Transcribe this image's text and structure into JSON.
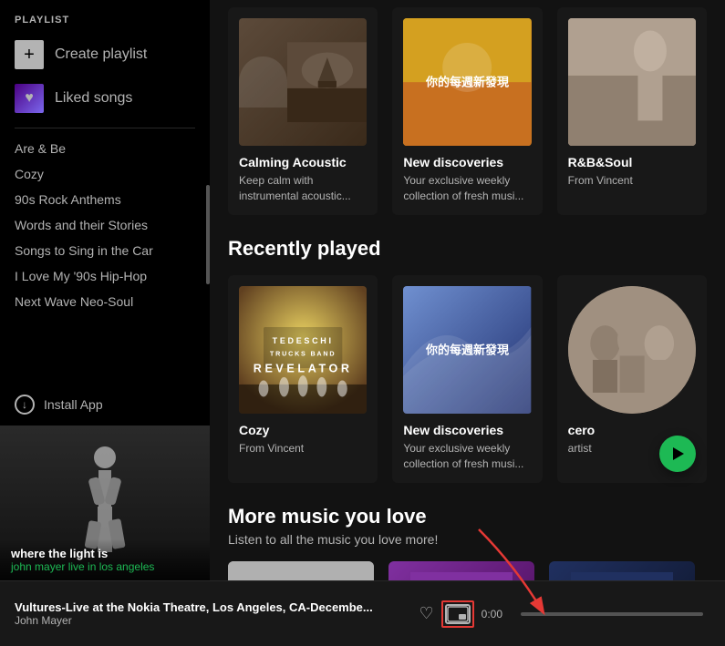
{
  "sidebar": {
    "section_title": "PLAYLIST",
    "create_playlist_label": "Create playlist",
    "liked_songs_label": "Liked songs",
    "playlists": [
      {
        "id": "are-be",
        "label": "Are & Be"
      },
      {
        "id": "cozy",
        "label": "Cozy"
      },
      {
        "id": "90s-rock",
        "label": "90s Rock Anthems"
      },
      {
        "id": "words-stories",
        "label": "Words and their Stories"
      },
      {
        "id": "songs-car",
        "label": "Songs to Sing in the Car"
      },
      {
        "id": "hiphop",
        "label": "I Love My '90s Hip-Hop"
      },
      {
        "id": "neo-soul",
        "label": "Next Wave Neo-Soul"
      }
    ],
    "install_app_label": "Install App",
    "now_playing": {
      "title": "where the light is",
      "artist": "john mayer live in los angeles"
    }
  },
  "main": {
    "top_section": {
      "cards": [
        {
          "title": "Calming Acoustic",
          "subtitle": "Keep calm with instrumental acoustic..."
        },
        {
          "title": "New discoveries",
          "subtitle": "Your exclusive weekly collection of fresh musi...",
          "chinese_text": "你的每週新發現"
        },
        {
          "title": "R&B&Soul",
          "subtitle": "From Vincent"
        }
      ]
    },
    "recently_played": {
      "section_title": "Recently played",
      "cards": [
        {
          "id": "cozy",
          "title": "Cozy",
          "subtitle": "From Vincent"
        },
        {
          "id": "new-discoveries",
          "title": "New discoveries",
          "subtitle": "Your exclusive weekly collection of fresh musi...",
          "chinese_text": "你的每週新發現"
        },
        {
          "id": "cero",
          "title": "cero",
          "subtitle": "artist",
          "is_artist": true
        }
      ]
    },
    "more_music": {
      "section_title": "More music you love",
      "subtitle": "Listen to all the music you love more!"
    }
  },
  "player": {
    "track_title": "Vultures-Live at the Nokia Theatre, Los Angeles, CA-Decembe...",
    "track_artist": "John Mayer",
    "time_current": "",
    "time_total": "0:00",
    "heart_icon": "♡",
    "pip_icon": "pip"
  },
  "icons": {
    "plus": "+",
    "heart_filled": "♥",
    "download_circle": "⊕",
    "play": "▶"
  },
  "colors": {
    "green": "#1db954",
    "dark_bg": "#121212",
    "sidebar_bg": "#000000",
    "card_bg": "#181818",
    "text_primary": "#ffffff",
    "text_secondary": "#b3b3b3",
    "red_highlight": "#e53935"
  }
}
